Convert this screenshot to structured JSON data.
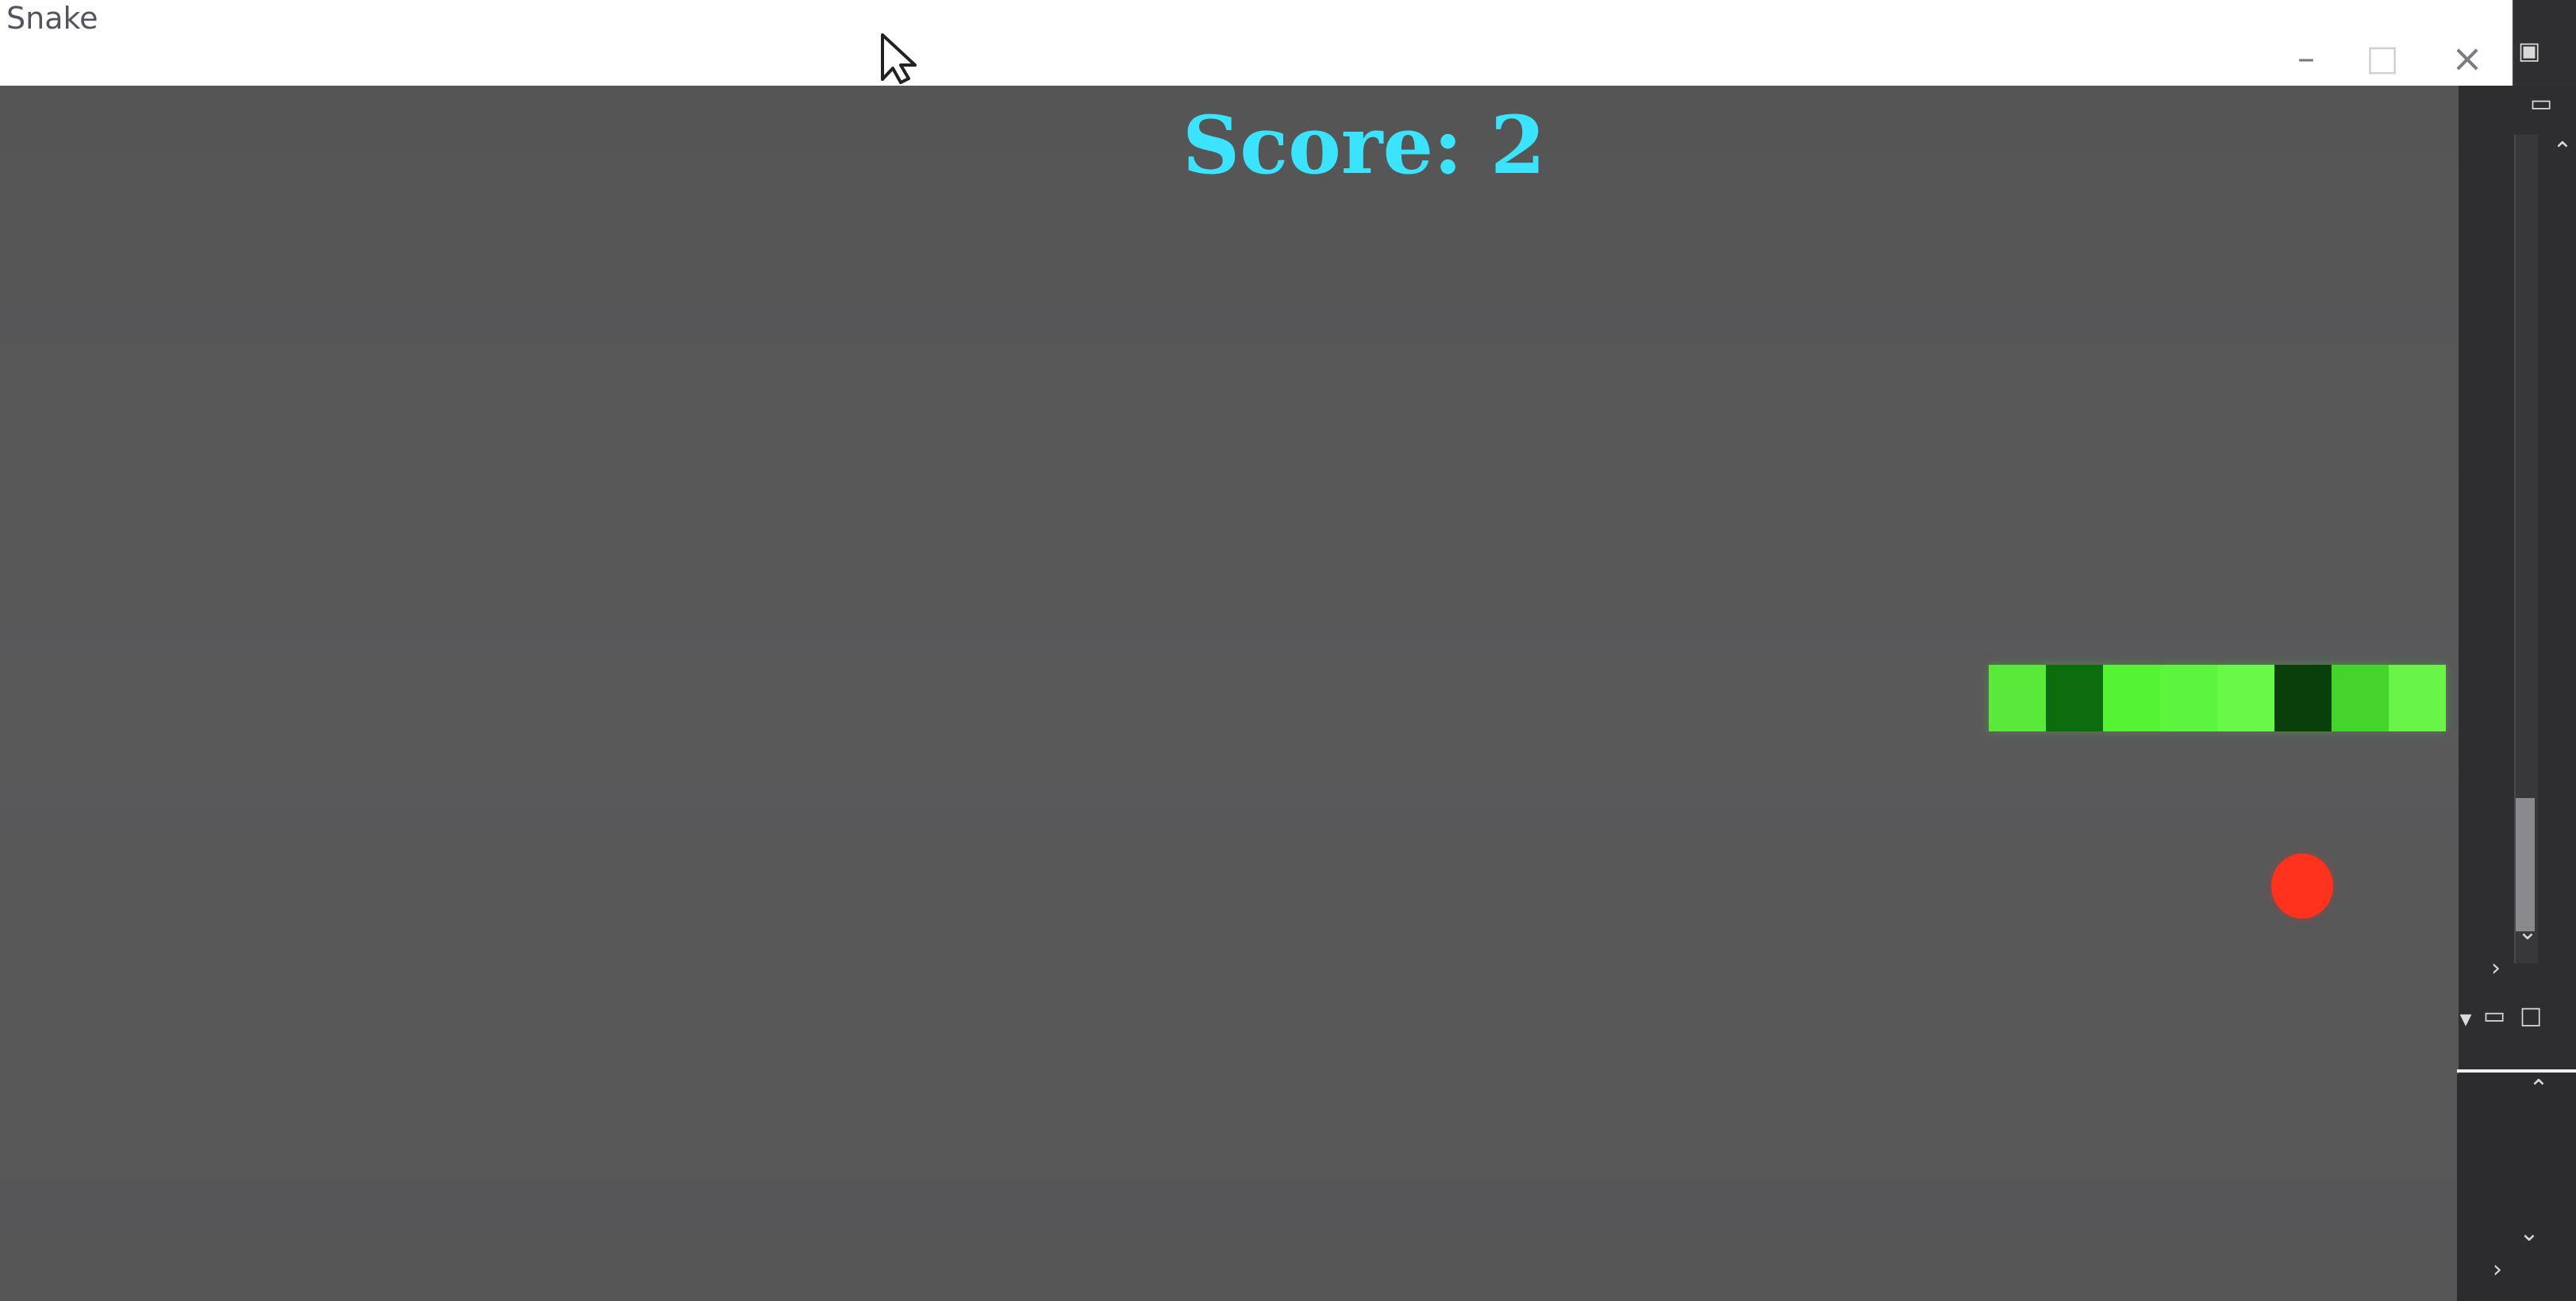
{
  "window": {
    "title": "Snake",
    "minimize_icon": "minimize-icon",
    "maximize_icon": "maximize-icon",
    "close_icon": "close-icon"
  },
  "game": {
    "score_text": "Score: 2",
    "background": "#555556",
    "score_color": "#3be3ff",
    "snake_colors": [
      "#58e93b",
      "#0b6d0b",
      "#54f435",
      "#5cf43f",
      "#67f848",
      "#093f0b",
      "#43d52b",
      "#68f448"
    ],
    "food_color": "#ff321d"
  },
  "side": {
    "icons": [
      "window-icon",
      "minimize-icon",
      "collapse-up-icon",
      "scroll-down-icon",
      "chevron-right-icon",
      "dropdown-icon",
      "minimize-icon",
      "restore-icon",
      "chevron-up-icon",
      "chevron-down-icon",
      "chevron-right-icon"
    ]
  }
}
